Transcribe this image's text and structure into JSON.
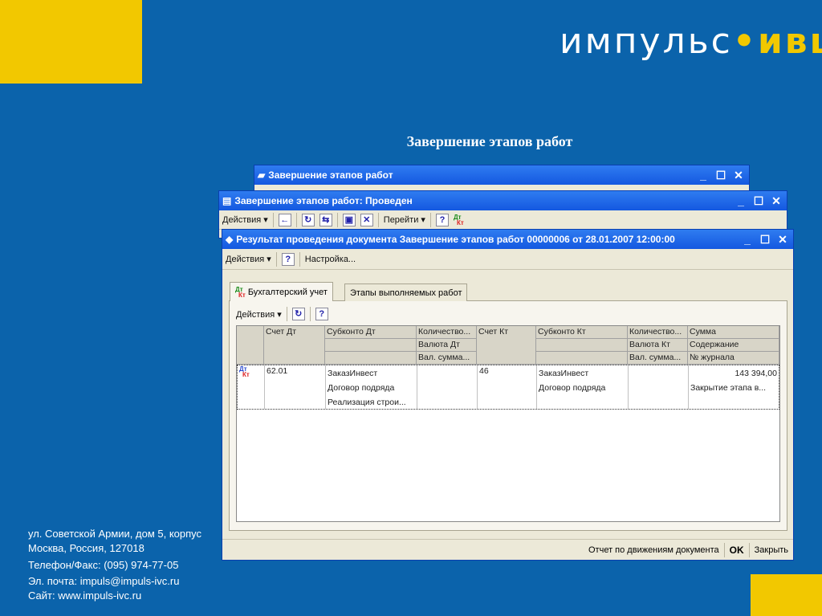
{
  "logo": {
    "part1": "импульс",
    "dot": "•",
    "part2": "ивц"
  },
  "slide_title": "Завершение этапов работ",
  "back_window": {
    "title": "Завершение этапов работ"
  },
  "middle_window": {
    "title": "Завершение этапов работ: Проведен",
    "actions": "Действия ▾",
    "goto": "Перейти ▾",
    "help": "?"
  },
  "front_window": {
    "title": "Результат проведения документа Завершение этапов работ 00000006 от 28.01.2007 12:00:00",
    "toolbar": {
      "actions": "Действия ▾",
      "help": "?",
      "settings": "Настройка..."
    },
    "tabs": [
      {
        "label": "Бухгалтерский учет"
      },
      {
        "label": "Этапы выполняемых работ"
      }
    ],
    "grid_toolbar": {
      "actions": "Действия ▾",
      "help": "?"
    },
    "headers": {
      "schet_dt": "Счет Дт",
      "subkonto_dt": "Субконто Дт",
      "kol_dt": "Количество...",
      "valuta_dt": "Валюта Дт",
      "valsum_dt": "Вал. сумма...",
      "schet_kt": "Счет Кт",
      "subkonto_kt": "Субконто Кт",
      "kol_kt": "Количество...",
      "valuta_kt": "Валюта Кт",
      "valsum_kt": "Вал. сумма...",
      "summa": "Сумма",
      "soderzhanie": "Содержание",
      "journal": "№ журнала"
    },
    "row": {
      "schet_dt": "62.01",
      "subkonto_dt": [
        "ЗаказИнвест",
        "Договор подряда",
        "Реализация строи..."
      ],
      "schet_kt": "46",
      "subkonto_kt": [
        "ЗаказИнвест",
        "Договор подряда"
      ],
      "summa": "143 394,00",
      "soderzhanie": "Закрытие этапа в..."
    },
    "status": {
      "report": "Отчет по движениям документа",
      "ok": "OK",
      "close": "Закрыть"
    },
    "dk": {
      "d": "Дт",
      "k": "Кт"
    }
  },
  "window_buttons": {
    "min": "_",
    "max": "☐",
    "close": "✕"
  },
  "address": {
    "line1": "ул. Советской Армии, дом 5, корпус",
    "line2": "Москва, Россия, 127018",
    "phone": "Телефон/Факс: (095) 974-77-05",
    "email": "Эл. почта: impuls@impuls-ivc.ru",
    "site": "Сайт: www.impuls-ivc.ru"
  }
}
